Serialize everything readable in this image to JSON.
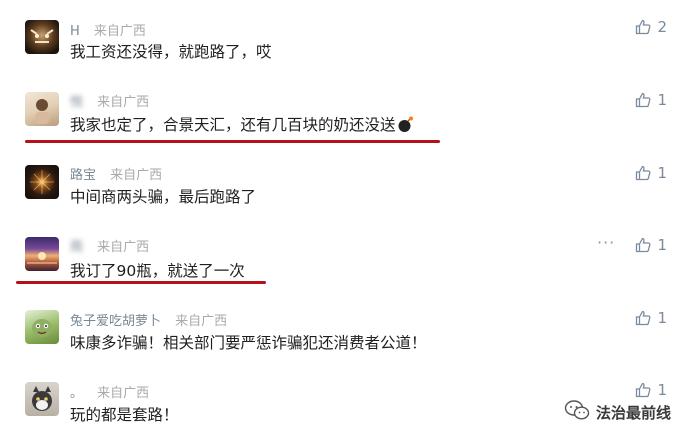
{
  "comments": [
    {
      "name": "H",
      "source": "来自广西",
      "text": "我工资还没得，就跑路了，哎",
      "likes": "2"
    },
    {
      "name": "悦",
      "source": "来自广西",
      "text": "我家也定了，合景天汇，还有几百块的奶还没送",
      "likes": "1"
    },
    {
      "name": "路宝",
      "source": "来自广西",
      "text": "中间商两头骗，最后跑路了",
      "likes": "1"
    },
    {
      "name": "雨",
      "source": "来自广西",
      "text": "我订了90瓶，就送了一次",
      "likes": "1"
    },
    {
      "name": "兔子爱吃胡萝卜",
      "source": "来自广西",
      "text": "味康多诈骗！相关部门要严惩诈骗犯还消费者公道！",
      "likes": "1"
    },
    {
      "name": "。",
      "source": "来自广西",
      "text": "玩的都是套路！",
      "likes": "1"
    }
  ],
  "more_label": "···",
  "watermark": "法治最前线",
  "icons": {
    "like": "thumbs-up-icon",
    "more": "more-dots-icon",
    "watermark": "wechat-logo-icon"
  },
  "colors": {
    "underline": "#b3121b",
    "like": "#7b8a9c",
    "meta": "#aaaaaa"
  }
}
